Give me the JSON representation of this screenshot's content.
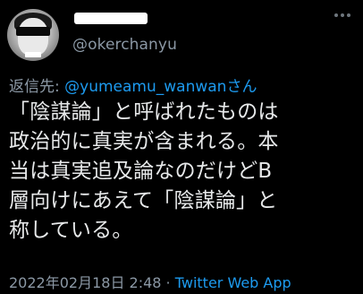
{
  "tweet": {
    "author": {
      "handle": "@okerchanyu",
      "avatar_icon": "profile-avatar"
    },
    "reply_to": {
      "label": "返信先:",
      "mention": "@yumeamu_wanwanさん"
    },
    "text_lines": [
      "「陰謀論」と呼ばれたものは",
      "政治的に真実が含まれる。本",
      "当は真実追及論なのだけどB",
      "層向けにあえて「陰謀論」と",
      "称している。"
    ],
    "timestamp": "2022年02月18日 2:48",
    "separator": " · ",
    "source_app": "Twitter Web App"
  },
  "colors": {
    "background": "#000000",
    "text": "#e7e9ea",
    "muted": "#8b98a5",
    "accent": "#1d9bf0"
  }
}
